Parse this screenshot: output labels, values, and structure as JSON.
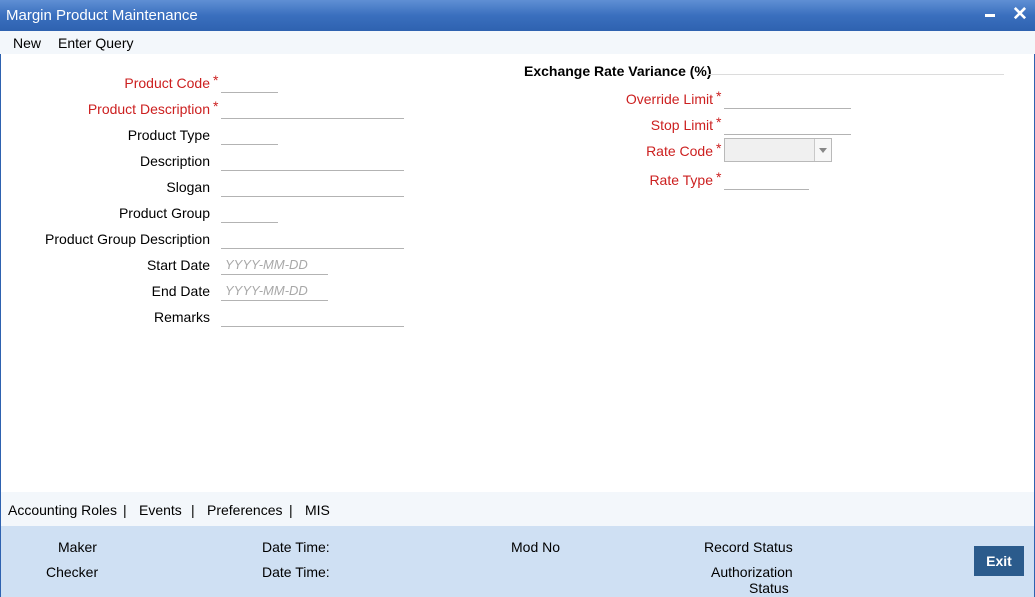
{
  "window": {
    "title": "Margin Product Maintenance"
  },
  "menu": {
    "new_label": "New",
    "enter_query_label": "Enter Query"
  },
  "left_form": {
    "product_code": "Product Code",
    "product_description": "Product Description",
    "product_type": "Product Type",
    "description": "Description",
    "slogan": "Slogan",
    "product_group": "Product Group",
    "product_group_description": "Product Group Description",
    "start_date": "Start Date",
    "end_date": "End Date",
    "remarks": "Remarks",
    "date_placeholder": "YYYY-MM-DD",
    "required_mark": "*"
  },
  "right_form": {
    "section_title": "Exchange Rate Variance (%)",
    "override_limit": "Override Limit",
    "stop_limit": "Stop Limit",
    "rate_code": "Rate Code",
    "rate_type": "Rate Type"
  },
  "subnav": {
    "accounting_roles": "Accounting Roles",
    "events": "Events",
    "preferences": "Preferences",
    "mis": "MIS",
    "separator": "|"
  },
  "footer": {
    "maker": "Maker",
    "checker": "Checker",
    "date_time_1": "Date Time:",
    "date_time_2": "Date Time:",
    "mod_no": "Mod No",
    "record_status": "Record Status",
    "authorization": "Authorization",
    "status": "Status",
    "exit_label": "Exit"
  },
  "colors": {
    "title_bar": "#3a6fbe",
    "required": "#cc1f1f",
    "footer_bg": "#cfe0f3",
    "exit_button": "#2b5b8c"
  },
  "icons": {
    "minimize": "minimize-icon",
    "close": "close-icon",
    "dropdown": "chevron-down-icon"
  }
}
